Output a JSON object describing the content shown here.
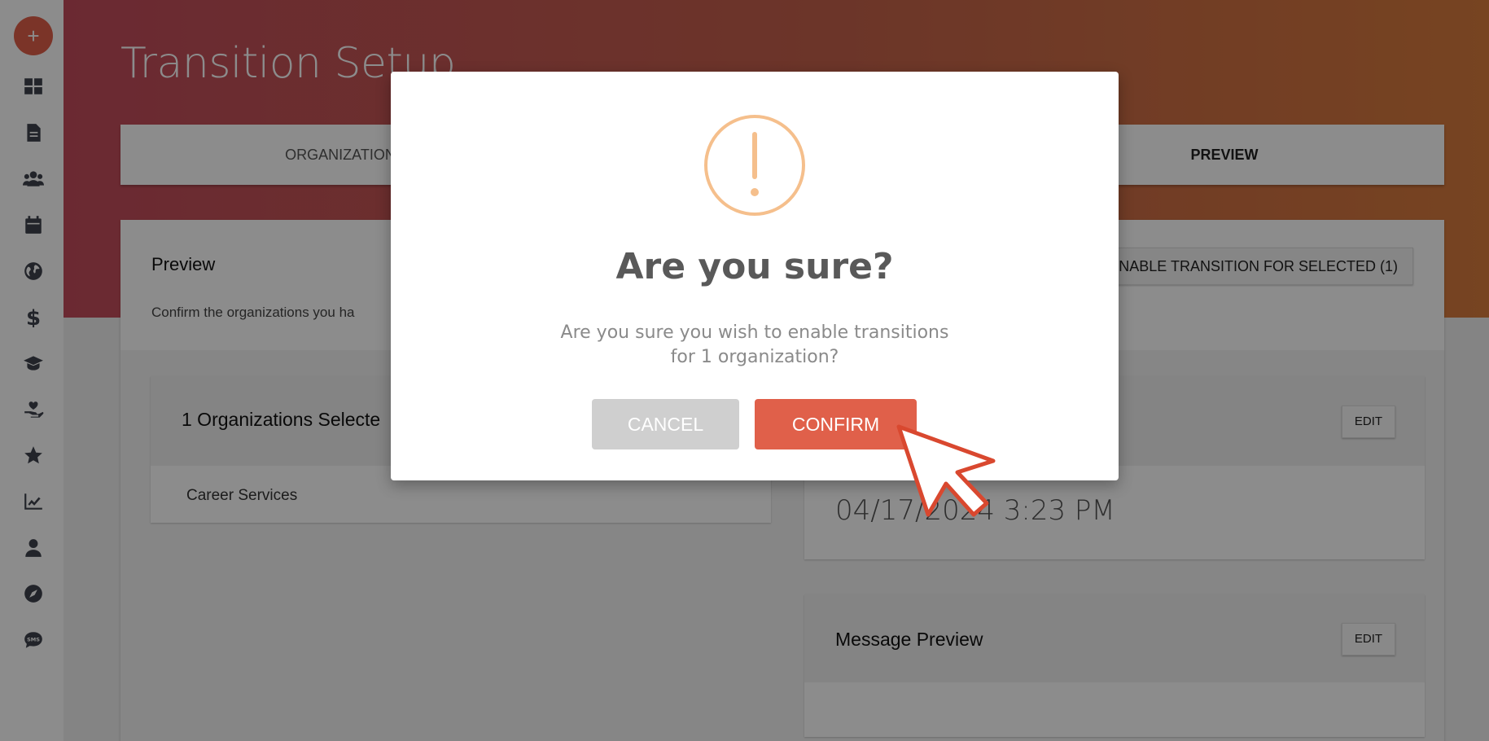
{
  "sidebar": {
    "add_label": "+",
    "icons": [
      "dashboard-icon",
      "document-icon",
      "users-icon",
      "calendar-icon",
      "globe-icon",
      "dollar-icon",
      "graduation-cap-icon",
      "hand-heart-icon",
      "star-icon",
      "chart-line-icon",
      "user-icon",
      "compass-icon",
      "sms-icon"
    ]
  },
  "header": {
    "title": "Transition Setup"
  },
  "tabs": {
    "organization": "ORGANIZATION",
    "preview": "PREVIEW"
  },
  "card": {
    "title": "Preview",
    "subtitle": "Confirm the organizations you ha",
    "enable_button": "NABLE TRANSITION FOR SELECTED (1)"
  },
  "organizations_panel": {
    "title": "1 Organizations Selecte",
    "items": [
      "Career Services"
    ]
  },
  "date_panel": {
    "edit_label": "EDIT",
    "value": "04/17/2024 3:23 PM"
  },
  "message_panel": {
    "title": "Message Preview",
    "edit_label": "EDIT"
  },
  "modal": {
    "title": "Are you sure?",
    "text": "Are you sure you wish to enable transitions for 1 organization?",
    "cancel_label": "CANCEL",
    "confirm_label": "CONFIRM"
  },
  "colors": {
    "accent": "#e0604a",
    "warning": "#f5bf8c",
    "cancel": "#cfcfcf"
  }
}
